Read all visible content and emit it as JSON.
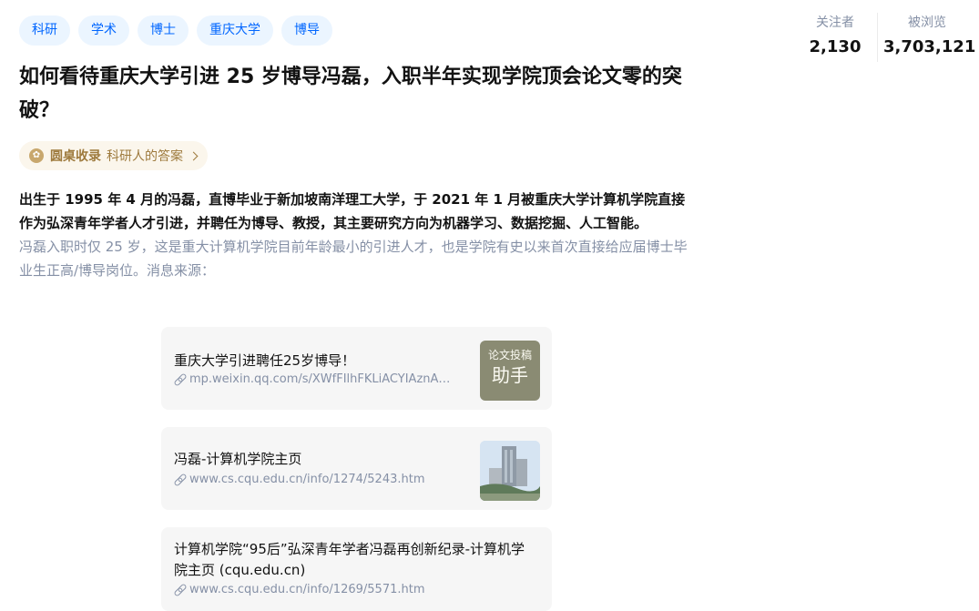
{
  "topics": [
    "科研",
    "学术",
    "博士",
    "重庆大学",
    "博导"
  ],
  "stats": {
    "followers_label": "关注者",
    "followers_value": "2,130",
    "views_label": "被浏览",
    "views_value": "3,703,121"
  },
  "question": {
    "title": "如何看待重庆大学引进 25 岁博导冯磊，入职半年实现学院顶会论文零的突破？"
  },
  "collection": {
    "badge_icon": "roundtable-icon",
    "title": "圆桌收录",
    "subtitle": "科研人的答案"
  },
  "content": {
    "bold_paragraph": "出生于 1995 年 4 月的冯磊，直博毕业于新加坡南洋理工大学，于 2021 年 1 月被重庆大学计算机学院直接作为弘深青年学者人才引进，并聘任为博导、教授，其主要研究方向为机器学习、数据挖掘、人工智能。",
    "grey_paragraph": "冯磊入职时仅 25 岁，这是重大计算机学院目前年龄最小的引进人才，也是学院有史以来首次直接给应届博士毕业生正高/博导岗位。消息来源："
  },
  "link_cards": [
    {
      "title": "重庆大学引进聘任25岁博导！",
      "url": "mp.weixin.qq.com/s/XWfFIlhFKLiACYIAznA…",
      "thumb_line1": "论文投稿",
      "thumb_line2": "助手"
    },
    {
      "title": "冯磊-计算机学院主页",
      "url": "www.cs.cqu.edu.cn/info/1274/5243.htm"
    },
    {
      "title": "计算机学院“95后”弘深青年学者冯磊再创新纪录-计算机学院主页 (cqu.edu.cn)",
      "url": "www.cs.cqu.edu.cn/info/1269/5571.htm"
    }
  ],
  "colors": {
    "topic_text": "#0066ff",
    "topic_bg": "#ebf5ff",
    "muted_text": "#8590a6",
    "collection_text": "#9e7a3d",
    "collection_bg": "#fbf6ec"
  }
}
